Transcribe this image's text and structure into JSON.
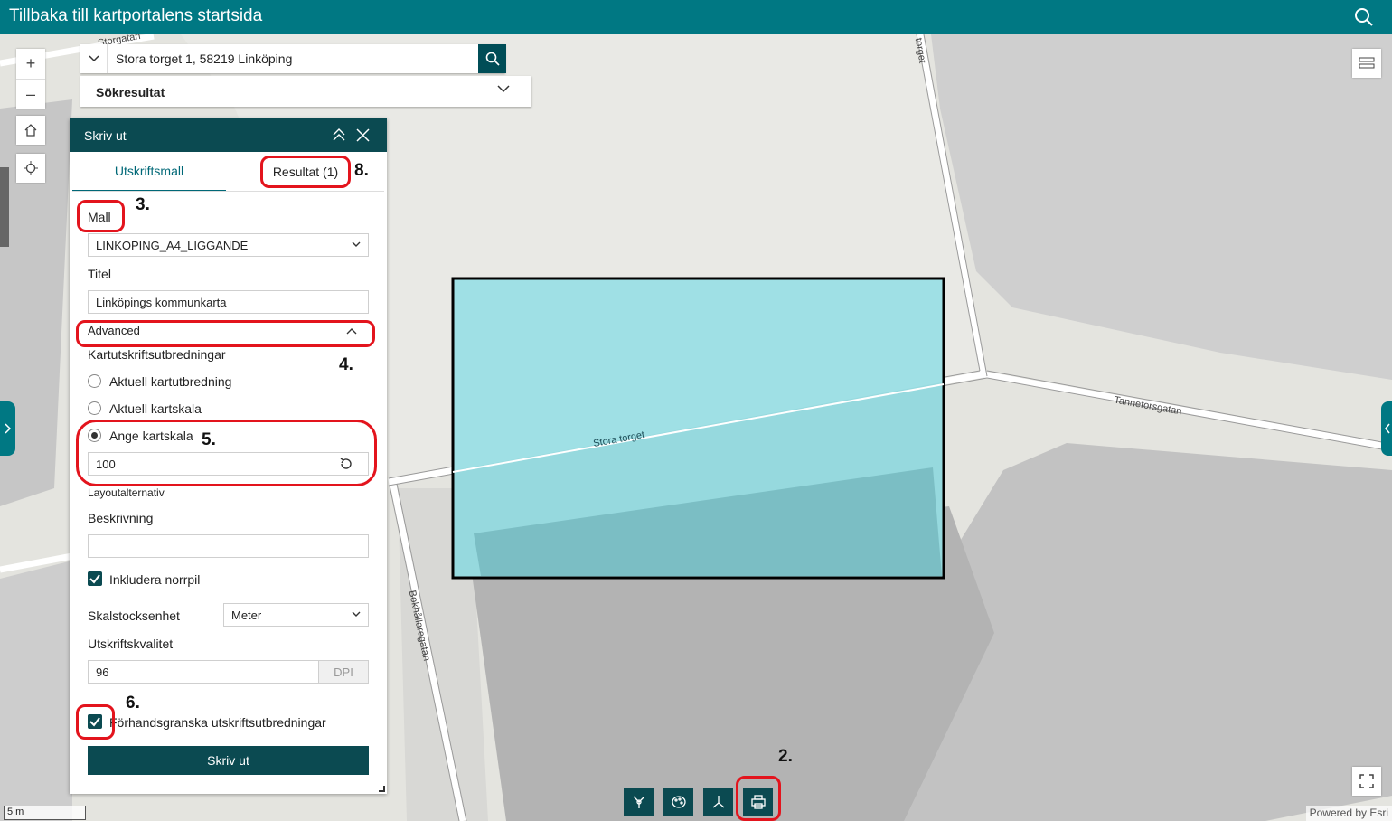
{
  "header": {
    "title": "Tillbaka till kartportalens startsida",
    "search_icon": "search-icon"
  },
  "map": {
    "street_labels": [
      "Storgatan",
      "torget",
      "Stora torget",
      "Tanneforsgatan",
      "Bokhållaregatan"
    ],
    "scale_label": "5 m",
    "attribution": "Powered by Esri"
  },
  "search": {
    "value": "Stora torget 1, 58219 Linköping",
    "results_label": "Sökresultat"
  },
  "zoom": {
    "in": "+",
    "out": "–"
  },
  "print_panel": {
    "title": "Skriv ut",
    "tabs": [
      {
        "label": "Utskriftsmall"
      },
      {
        "label": "Resultat (1)"
      }
    ],
    "template_label": "Mall",
    "template_value": "LINKOPING_A4_LIGGANDE",
    "title_label": "Titel",
    "title_value": "Linköpings kommunkarta",
    "advanced_label": "Advanced",
    "extent_heading": "Kartutskriftsutbredningar",
    "radio_options": [
      {
        "label": "Aktuell kartutbredning",
        "selected": false
      },
      {
        "label": "Aktuell kartskala",
        "selected": false
      },
      {
        "label": "Ange kartskala",
        "selected": true
      }
    ],
    "scale_value": "100",
    "layout_heading": "Layoutalternativ",
    "description_label": "Beskrivning",
    "description_value": "",
    "north_arrow_label": "Inkludera norrpil",
    "north_arrow_checked": true,
    "scalebar_unit_label": "Skalstocksenhet",
    "scalebar_unit_value": "Meter",
    "quality_label": "Utskriftskvalitet",
    "quality_value": "96",
    "quality_unit": "DPI",
    "preview_label": "Förhandsgranska utskriftsutbredningar",
    "preview_checked": true,
    "print_button": "Skriv ut"
  },
  "annotations": [
    "2.",
    "3.",
    "4.",
    "5.",
    "6.",
    "8."
  ],
  "colors": {
    "header": "#007883",
    "panel_header": "#0b4a51",
    "print_extent_fill": "#9fe0e5",
    "annotation": "#e3141d"
  }
}
